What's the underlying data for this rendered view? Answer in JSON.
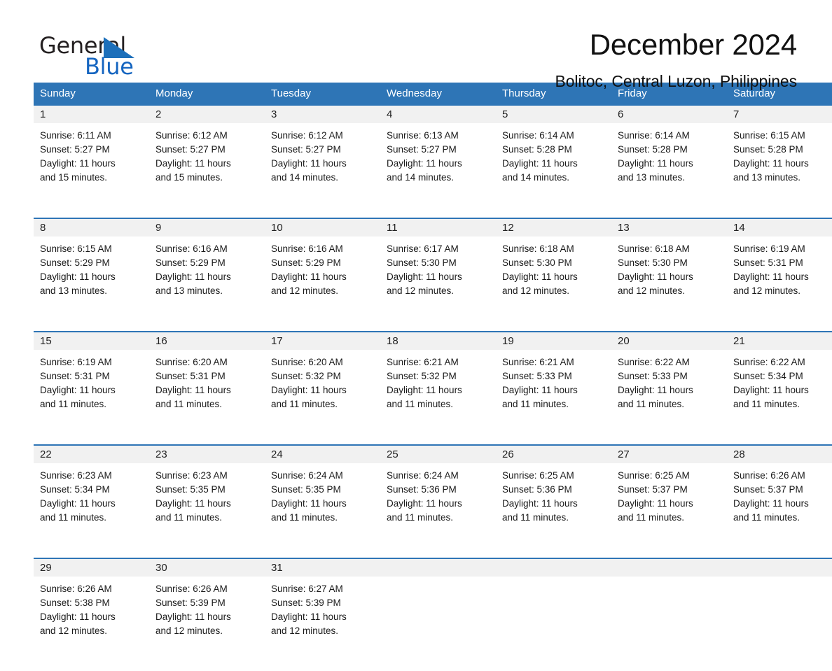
{
  "logo": {
    "word_general": "General",
    "word_blue": "Blue",
    "triangle_color": "#1c6fba"
  },
  "header": {
    "month_title": "December 2024",
    "location": "Bolitoc, Central Luzon, Philippines"
  },
  "theme": {
    "header_blue": "#2e75b6",
    "daynum_band": "#f1f1f1",
    "text": "#1a1a1a"
  },
  "weekdays": [
    "Sunday",
    "Monday",
    "Tuesday",
    "Wednesday",
    "Thursday",
    "Friday",
    "Saturday"
  ],
  "weeks": [
    {
      "days": [
        {
          "num": "1",
          "sunrise": "Sunrise: 6:11 AM",
          "sunset": "Sunset: 5:27 PM",
          "daylight_line1": "Daylight: 11 hours",
          "daylight_line2": "and 15 minutes."
        },
        {
          "num": "2",
          "sunrise": "Sunrise: 6:12 AM",
          "sunset": "Sunset: 5:27 PM",
          "daylight_line1": "Daylight: 11 hours",
          "daylight_line2": "and 15 minutes."
        },
        {
          "num": "3",
          "sunrise": "Sunrise: 6:12 AM",
          "sunset": "Sunset: 5:27 PM",
          "daylight_line1": "Daylight: 11 hours",
          "daylight_line2": "and 14 minutes."
        },
        {
          "num": "4",
          "sunrise": "Sunrise: 6:13 AM",
          "sunset": "Sunset: 5:27 PM",
          "daylight_line1": "Daylight: 11 hours",
          "daylight_line2": "and 14 minutes."
        },
        {
          "num": "5",
          "sunrise": "Sunrise: 6:14 AM",
          "sunset": "Sunset: 5:28 PM",
          "daylight_line1": "Daylight: 11 hours",
          "daylight_line2": "and 14 minutes."
        },
        {
          "num": "6",
          "sunrise": "Sunrise: 6:14 AM",
          "sunset": "Sunset: 5:28 PM",
          "daylight_line1": "Daylight: 11 hours",
          "daylight_line2": "and 13 minutes."
        },
        {
          "num": "7",
          "sunrise": "Sunrise: 6:15 AM",
          "sunset": "Sunset: 5:28 PM",
          "daylight_line1": "Daylight: 11 hours",
          "daylight_line2": "and 13 minutes."
        }
      ]
    },
    {
      "days": [
        {
          "num": "8",
          "sunrise": "Sunrise: 6:15 AM",
          "sunset": "Sunset: 5:29 PM",
          "daylight_line1": "Daylight: 11 hours",
          "daylight_line2": "and 13 minutes."
        },
        {
          "num": "9",
          "sunrise": "Sunrise: 6:16 AM",
          "sunset": "Sunset: 5:29 PM",
          "daylight_line1": "Daylight: 11 hours",
          "daylight_line2": "and 13 minutes."
        },
        {
          "num": "10",
          "sunrise": "Sunrise: 6:16 AM",
          "sunset": "Sunset: 5:29 PM",
          "daylight_line1": "Daylight: 11 hours",
          "daylight_line2": "and 12 minutes."
        },
        {
          "num": "11",
          "sunrise": "Sunrise: 6:17 AM",
          "sunset": "Sunset: 5:30 PM",
          "daylight_line1": "Daylight: 11 hours",
          "daylight_line2": "and 12 minutes."
        },
        {
          "num": "12",
          "sunrise": "Sunrise: 6:18 AM",
          "sunset": "Sunset: 5:30 PM",
          "daylight_line1": "Daylight: 11 hours",
          "daylight_line2": "and 12 minutes."
        },
        {
          "num": "13",
          "sunrise": "Sunrise: 6:18 AM",
          "sunset": "Sunset: 5:30 PM",
          "daylight_line1": "Daylight: 11 hours",
          "daylight_line2": "and 12 minutes."
        },
        {
          "num": "14",
          "sunrise": "Sunrise: 6:19 AM",
          "sunset": "Sunset: 5:31 PM",
          "daylight_line1": "Daylight: 11 hours",
          "daylight_line2": "and 12 minutes."
        }
      ]
    },
    {
      "days": [
        {
          "num": "15",
          "sunrise": "Sunrise: 6:19 AM",
          "sunset": "Sunset: 5:31 PM",
          "daylight_line1": "Daylight: 11 hours",
          "daylight_line2": "and 11 minutes."
        },
        {
          "num": "16",
          "sunrise": "Sunrise: 6:20 AM",
          "sunset": "Sunset: 5:31 PM",
          "daylight_line1": "Daylight: 11 hours",
          "daylight_line2": "and 11 minutes."
        },
        {
          "num": "17",
          "sunrise": "Sunrise: 6:20 AM",
          "sunset": "Sunset: 5:32 PM",
          "daylight_line1": "Daylight: 11 hours",
          "daylight_line2": "and 11 minutes."
        },
        {
          "num": "18",
          "sunrise": "Sunrise: 6:21 AM",
          "sunset": "Sunset: 5:32 PM",
          "daylight_line1": "Daylight: 11 hours",
          "daylight_line2": "and 11 minutes."
        },
        {
          "num": "19",
          "sunrise": "Sunrise: 6:21 AM",
          "sunset": "Sunset: 5:33 PM",
          "daylight_line1": "Daylight: 11 hours",
          "daylight_line2": "and 11 minutes."
        },
        {
          "num": "20",
          "sunrise": "Sunrise: 6:22 AM",
          "sunset": "Sunset: 5:33 PM",
          "daylight_line1": "Daylight: 11 hours",
          "daylight_line2": "and 11 minutes."
        },
        {
          "num": "21",
          "sunrise": "Sunrise: 6:22 AM",
          "sunset": "Sunset: 5:34 PM",
          "daylight_line1": "Daylight: 11 hours",
          "daylight_line2": "and 11 minutes."
        }
      ]
    },
    {
      "days": [
        {
          "num": "22",
          "sunrise": "Sunrise: 6:23 AM",
          "sunset": "Sunset: 5:34 PM",
          "daylight_line1": "Daylight: 11 hours",
          "daylight_line2": "and 11 minutes."
        },
        {
          "num": "23",
          "sunrise": "Sunrise: 6:23 AM",
          "sunset": "Sunset: 5:35 PM",
          "daylight_line1": "Daylight: 11 hours",
          "daylight_line2": "and 11 minutes."
        },
        {
          "num": "24",
          "sunrise": "Sunrise: 6:24 AM",
          "sunset": "Sunset: 5:35 PM",
          "daylight_line1": "Daylight: 11 hours",
          "daylight_line2": "and 11 minutes."
        },
        {
          "num": "25",
          "sunrise": "Sunrise: 6:24 AM",
          "sunset": "Sunset: 5:36 PM",
          "daylight_line1": "Daylight: 11 hours",
          "daylight_line2": "and 11 minutes."
        },
        {
          "num": "26",
          "sunrise": "Sunrise: 6:25 AM",
          "sunset": "Sunset: 5:36 PM",
          "daylight_line1": "Daylight: 11 hours",
          "daylight_line2": "and 11 minutes."
        },
        {
          "num": "27",
          "sunrise": "Sunrise: 6:25 AM",
          "sunset": "Sunset: 5:37 PM",
          "daylight_line1": "Daylight: 11 hours",
          "daylight_line2": "and 11 minutes."
        },
        {
          "num": "28",
          "sunrise": "Sunrise: 6:26 AM",
          "sunset": "Sunset: 5:37 PM",
          "daylight_line1": "Daylight: 11 hours",
          "daylight_line2": "and 11 minutes."
        }
      ]
    },
    {
      "days": [
        {
          "num": "29",
          "sunrise": "Sunrise: 6:26 AM",
          "sunset": "Sunset: 5:38 PM",
          "daylight_line1": "Daylight: 11 hours",
          "daylight_line2": "and 12 minutes."
        },
        {
          "num": "30",
          "sunrise": "Sunrise: 6:26 AM",
          "sunset": "Sunset: 5:39 PM",
          "daylight_line1": "Daylight: 11 hours",
          "daylight_line2": "and 12 minutes."
        },
        {
          "num": "31",
          "sunrise": "Sunrise: 6:27 AM",
          "sunset": "Sunset: 5:39 PM",
          "daylight_line1": "Daylight: 11 hours",
          "daylight_line2": "and 12 minutes."
        },
        {
          "num": "",
          "sunrise": "",
          "sunset": "",
          "daylight_line1": "",
          "daylight_line2": ""
        },
        {
          "num": "",
          "sunrise": "",
          "sunset": "",
          "daylight_line1": "",
          "daylight_line2": ""
        },
        {
          "num": "",
          "sunrise": "",
          "sunset": "",
          "daylight_line1": "",
          "daylight_line2": ""
        },
        {
          "num": "",
          "sunrise": "",
          "sunset": "",
          "daylight_line1": "",
          "daylight_line2": ""
        }
      ]
    }
  ]
}
